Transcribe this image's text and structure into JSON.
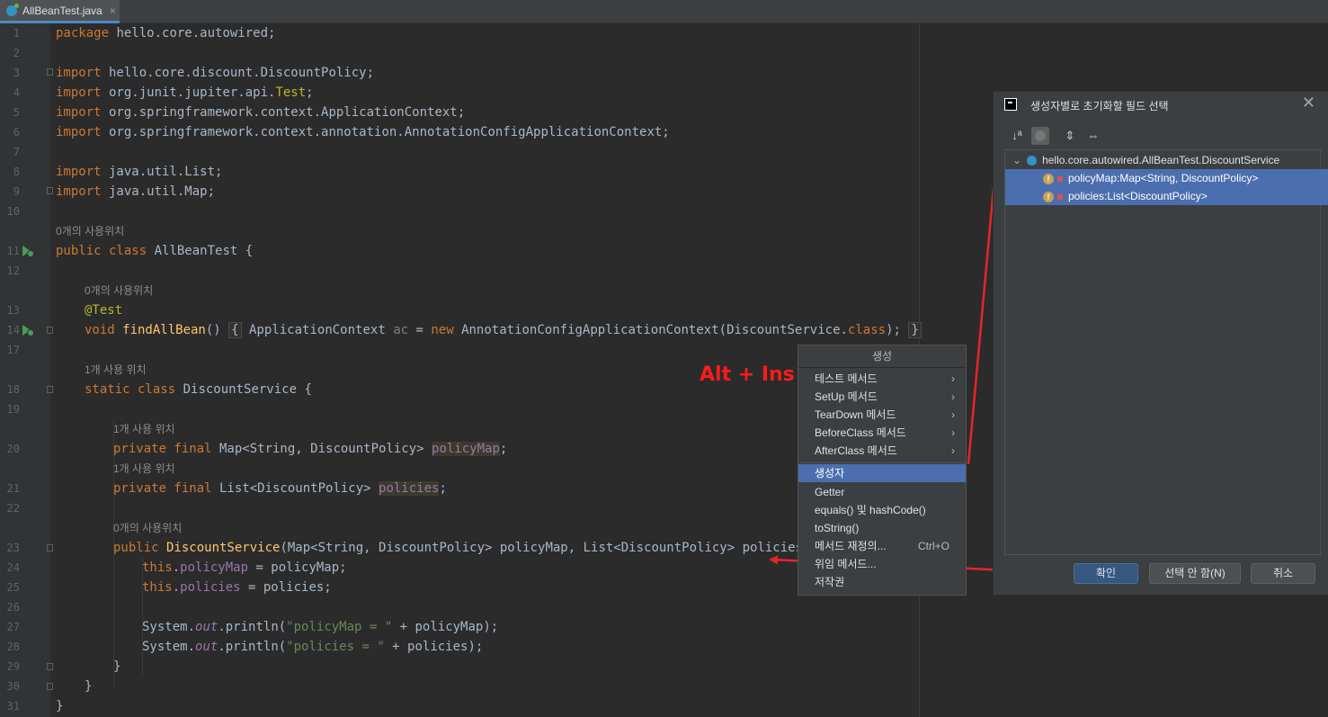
{
  "tab": {
    "label": "AllBeanTest.java",
    "close": "×"
  },
  "lines": [
    "1",
    "2",
    "3",
    "4",
    "5",
    "6",
    "7",
    "8",
    "9",
    "10",
    "11",
    "12",
    "13",
    "14",
    "17",
    "18",
    "19",
    "20",
    "21",
    "22",
    "23",
    "24",
    "25",
    "26",
    "27",
    "28",
    "29",
    "30",
    "31"
  ],
  "code": {
    "l1_kw": "package",
    "l1_rest": " hello.core.autowired;",
    "l3_kw": "import",
    "l3_rest": " hello.core.discount.DiscountPolicy;",
    "l4_kw": "import",
    "l4_rest": " org.junit.jupiter.api.",
    "l4_ann": "Test",
    "l4_end": ";",
    "l5_kw": "import",
    "l5_rest": " org.springframework.context.ApplicationContext;",
    "l6_kw": "import",
    "l6_rest": " org.springframework.context.annotation.AnnotationConfigApplicationContext;",
    "l8_kw": "import",
    "l8_rest": " java.util.List;",
    "l9_kw": "import",
    "l9_rest": " java.util.Map;",
    "hint_class": "0개의 사용위치",
    "l11_kw": "public class",
    "l11_rest": " AllBeanTest {",
    "hint_test": "0개의 사용위치",
    "l13_ann": "@Test",
    "l14_kw": "void",
    "l14_fn": " findAllBean",
    "l14_paren": "()",
    "l14_open": "{",
    "l14_body": " ApplicationContext ",
    "l14_ac": "ac",
    "l14_eq": " = ",
    "l14_new": "new",
    "l14_call": " AnnotationConfigApplicationContext(DiscountService.",
    "l14_class": "class",
    "l14_end": ");",
    "l14_close": "}",
    "hint_ds": "1개 사용 위치",
    "l18_kw": "static class",
    "l18_rest": " DiscountService {",
    "hint_pm": "1개 사용 위치",
    "l20_kw": "private final",
    "l20_type": " Map<String, DiscountPolicy> ",
    "l20_fld": "policyMap",
    "l20_end": ";",
    "hint_pol": "1개 사용 위치",
    "l21_kw": "private final",
    "l21_type": " List<DiscountPolicy> ",
    "l21_fld": "policies",
    "l21_end": ";",
    "hint_ctor": "0개의 사용위치",
    "l23_kw": "public",
    "l23_fn": " DiscountService",
    "l23_rest": "(Map<String, DiscountPolicy> policyMap, List<DiscountPolicy> policies) {",
    "l24_this": "this",
    "l24_dot": ".",
    "l24_fld": "policyMap",
    "l24_rest": " = policyMap;",
    "l25_this": "this",
    "l25_dot": ".",
    "l25_fld": "policies",
    "l25_rest": " = policies;",
    "l27_a": "System.",
    "l27_out": "out",
    "l27_b": ".println(",
    "l27_str": "\"policyMap = \"",
    "l27_c": " + policyMap);",
    "l28_a": "System.",
    "l28_out": "out",
    "l28_b": ".println(",
    "l28_str": "\"policies = \"",
    "l28_c": " + policies);",
    "l29": "}",
    "l30": "}",
    "l31": "}"
  },
  "annotation": {
    "label": "Alt + Ins",
    "color": "#ff1a1a"
  },
  "generate_menu": {
    "title": "생성",
    "items": [
      {
        "label": "테스트 메서드",
        "arrow": "›"
      },
      {
        "label": "SetUp 메서드",
        "arrow": "›"
      },
      {
        "label": "TearDown 메서드",
        "arrow": "›"
      },
      {
        "label": "BeforeClass 메서드",
        "arrow": "›"
      },
      {
        "label": "AfterClass 메서드",
        "arrow": "›"
      },
      {
        "label": "생성자"
      },
      {
        "label": "Getter"
      },
      {
        "label": "equals() 및 hashCode()"
      },
      {
        "label": "toString()"
      },
      {
        "label": "메서드 재정의...",
        "shortcut": "Ctrl+O"
      },
      {
        "label": "위임 메서드..."
      },
      {
        "label": "저작권"
      }
    ],
    "selected_label": "생성자"
  },
  "dialog": {
    "title": "생성자별로 초기화할 필드 선택",
    "close": "✕",
    "toolbar": {
      "sort": "↓ª",
      "expand": "⇕",
      "collapse": "⇔"
    },
    "tree": {
      "root": "hello.core.autowired.AllBeanTest.DiscountService",
      "fields": [
        "policyMap:Map<String, DiscountPolicy>",
        "policies:List<DiscountPolicy>"
      ]
    },
    "buttons": {
      "ok": "확인",
      "select_none": "선택 안 함(N)",
      "cancel": "취소"
    }
  },
  "colors": {
    "editor_bg": "#2b2b2b",
    "keyword": "#cc7832",
    "selection": "#4b6eaf"
  }
}
